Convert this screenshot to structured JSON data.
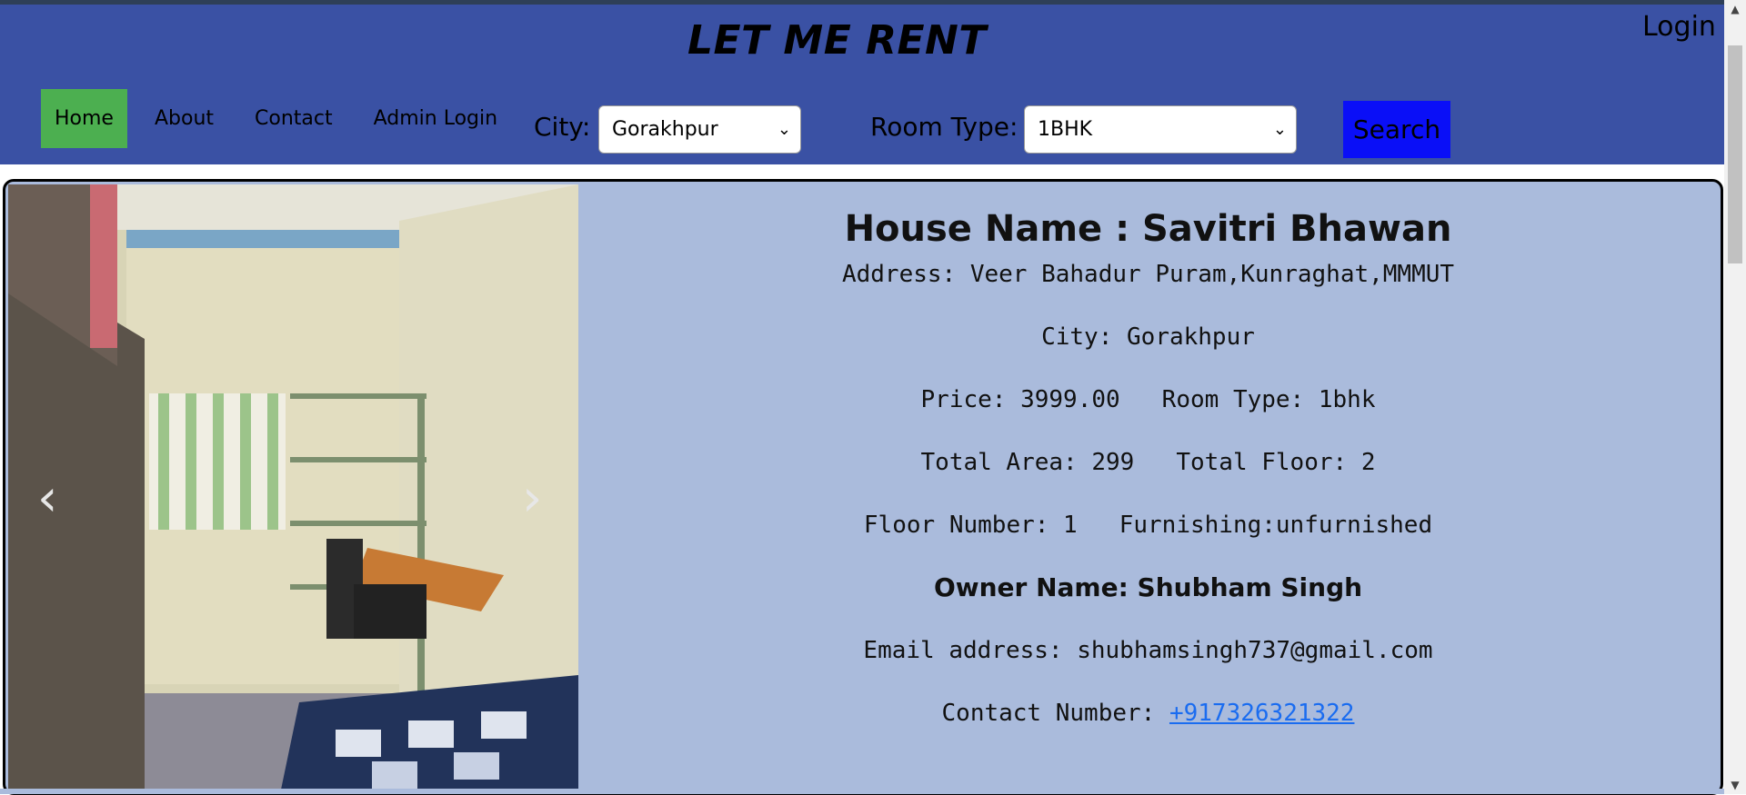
{
  "header": {
    "brand": "LET ME RENT",
    "login_label": "Login",
    "nav": {
      "home": "Home",
      "about": "About",
      "contact": "Contact",
      "admin_login": "Admin Login"
    },
    "city_label": "City:",
    "city_value": "Gorakhpur",
    "room_type_label": "Room Type:",
    "room_type_value": "1BHK",
    "search_label": "Search",
    "colors": {
      "header_bg": "#3a51a4",
      "active_nav": "#4caf50",
      "search_btn": "#0a0ff7"
    }
  },
  "listing": {
    "house_name": "House Name : Savitri Bhawan",
    "address": "Address: Veer Bahadur Puram,Kunraghat,MMMUT",
    "city": "City: Gorakhpur",
    "price": "Price: 3999.00",
    "room_type": "Room Type: 1bhk",
    "total_area": "Total Area: 299",
    "total_floor": "Total Floor: 2",
    "floor_number": "Floor Number: 1",
    "furnishing": "Furnishing:unfurnished",
    "owner_name": "Owner Name: Shubham Singh",
    "email": "Email address: shubhamsingh737@gmail.com",
    "contact_label": "Contact Number: ",
    "contact_number": "+917326321322",
    "carousel": {
      "prev_icon": "chevron-left-icon",
      "next_icon": "chevron-right-icon"
    },
    "colors": {
      "card_bg": "#aabbdc",
      "link": "#1a6cf0"
    }
  }
}
